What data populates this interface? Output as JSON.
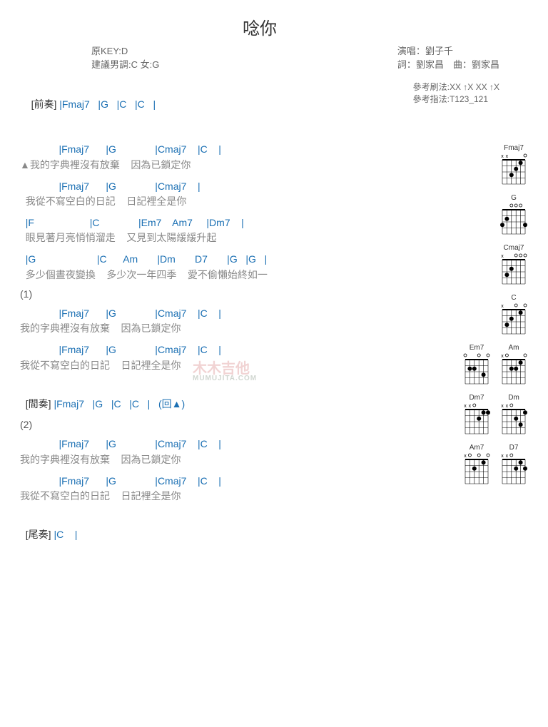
{
  "title": "唸你",
  "meta": {
    "key": "原KEY:D",
    "suggest": "建議男調:C 女:G",
    "singer_label": "演唱：",
    "singer": "劉子千",
    "lyric_label": "詞：",
    "lyricist": "劉家昌",
    "compose_label": "曲：",
    "composer": "劉家昌",
    "strum_label": "參考刷法:",
    "strum": "XX ↑X XX ↑X",
    "finger_label": "參考指法:",
    "finger": "T123_121"
  },
  "sections": {
    "intro_tag": "[前奏]",
    "intro_chords": "|Fmaj7   |G   |C   |C   |",
    "verse": [
      {
        "chords": "              |Fmaj7      |G              |Cmaj7    |C    |",
        "lyric": "▲我的字典裡沒有放棄    因為已鎖定你"
      },
      {
        "chords": "              |Fmaj7      |G              |Cmaj7    |",
        "lyric": "  我從不寫空白的日記    日記裡全是你"
      },
      {
        "chords": "  |F                    |C              |Em7    Am7     |Dm7    |",
        "lyric": "  眼見著月亮悄悄溜走    又見到太陽緩緩升起"
      },
      {
        "chords": "  |G                      |C      Am       |Dm       D7       |G   |G   |",
        "lyric": "  多少個晝夜變換    多少次一年四季    愛不偷懶始終如一"
      }
    ],
    "num1": "(1)",
    "block1": [
      {
        "chords": "              |Fmaj7      |G              |Cmaj7    |C    |",
        "lyric": "我的字典裡沒有放棄    因為已鎖定你"
      },
      {
        "chords": "              |Fmaj7      |G              |Cmaj7    |C    |",
        "lyric": "我從不寫空白的日記    日記裡全是你"
      }
    ],
    "inter_tag": "[間奏]",
    "inter_chords": "|Fmaj7   |G   |C   |C   |   (回▲)",
    "num2": "(2)",
    "block2": [
      {
        "chords": "              |Fmaj7      |G              |Cmaj7    |C    |",
        "lyric": "我的字典裡沒有放棄    因為已鎖定你"
      },
      {
        "chords": "              |Fmaj7      |G              |Cmaj7    |C    |",
        "lyric": "我從不寫空白的日記    日記裡全是你"
      }
    ],
    "outro_tag": "[尾奏]",
    "outro_chords": "|C    |"
  },
  "diagrams": [
    [
      "Fmaj7"
    ],
    [
      "G"
    ],
    [
      "Cmaj7"
    ],
    [
      "C"
    ],
    [
      "Em7",
      "Am"
    ],
    [
      "Dm7",
      "Dm"
    ],
    [
      "Am7",
      "D7"
    ]
  ],
  "watermark": {
    "main": "木木吉他",
    "sub": "MUMUJITA.COM"
  }
}
